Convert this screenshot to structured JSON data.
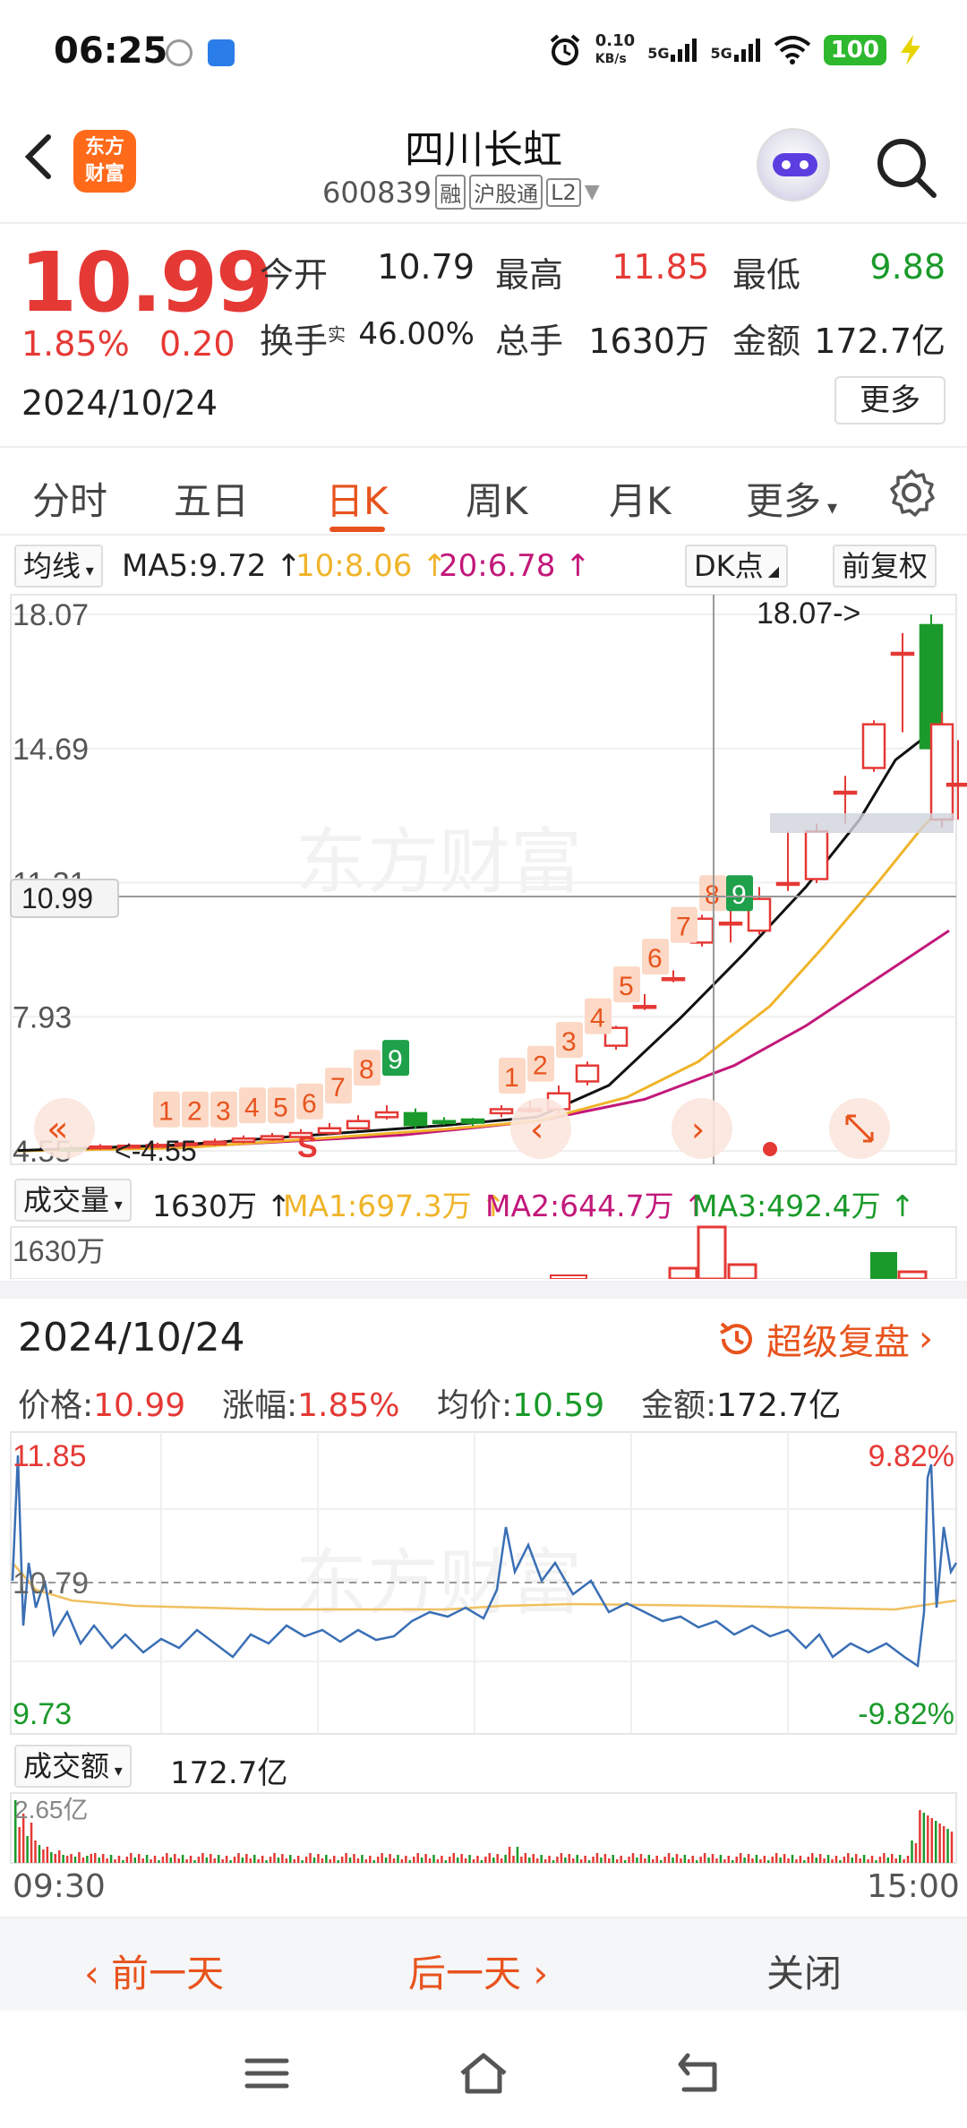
{
  "status": {
    "time": "06:25",
    "speed": "0.10",
    "speed_unit": "KB/s",
    "net1": "5G",
    "net2": "5G",
    "battery": "100"
  },
  "header": {
    "logo_line1": "东方",
    "logo_line2": "财富",
    "title": "四川长虹",
    "code": "600839",
    "tag1": "融",
    "tag2": "沪股通",
    "tag3": "L2"
  },
  "quote": {
    "price": "10.99",
    "pct": "1.85%",
    "change": "0.20",
    "date": "2024/10/24",
    "open_label": "今开",
    "open": "10.79",
    "high_label": "最高",
    "high": "11.85",
    "low_label": "最低",
    "low": "9.88",
    "turnover_label": "换手",
    "turnover_sup": "实",
    "turnover": "46.00%",
    "volume_label": "总手",
    "volume": "1630万",
    "amount_label": "金额",
    "amount": "172.7亿",
    "more": "更多"
  },
  "tabs": [
    "分时",
    "五日",
    "日K",
    "周K",
    "月K",
    "更多"
  ],
  "ma": {
    "selector": "均线",
    "ma5": "MA5:9.72",
    "ma10": "10:8.06",
    "ma20": "20:6.78",
    "dk": "DK点",
    "adjust": "前复权"
  },
  "kline": {
    "y_labels": [
      "18.07",
      "14.69",
      "11.31",
      "7.93",
      "4.55"
    ],
    "price_tag": "10.99",
    "max_label": "18.07->",
    "min_label": "<-4.55",
    "watermark": "东方财富"
  },
  "volume": {
    "selector": "成交量",
    "total": "1630万",
    "ma1": "MA1:697.3万",
    "ma2": "MA2:644.7万",
    "ma3": "MA3:492.4万",
    "axis": "1630万"
  },
  "detail": {
    "date": "2024/10/24",
    "replay": "超级复盘",
    "price_label": "价格:",
    "price": "10.99",
    "pct_label": "涨幅:",
    "pct": "1.85%",
    "avg_label": "均价:",
    "avg": "10.59",
    "amount_label": "金额:",
    "amount": "172.7亿"
  },
  "intraday": {
    "high": "11.85",
    "mid": "10.79",
    "low": "9.73",
    "pct_high": "9.82%",
    "pct_low": "-9.82%",
    "amt_selector": "成交额",
    "amt_total": "172.7亿",
    "amt_axis": "2.65亿",
    "t_start": "09:30",
    "t_end": "15:00"
  },
  "bottom": {
    "prev": "前一天",
    "next": "后一天",
    "close": "关闭"
  },
  "colors": {
    "up": "#e53935",
    "down": "#1a9a2a",
    "accent": "#e8531d",
    "ma5": "#111111",
    "ma10": "#f0b429",
    "ma20": "#c2187a"
  }
}
